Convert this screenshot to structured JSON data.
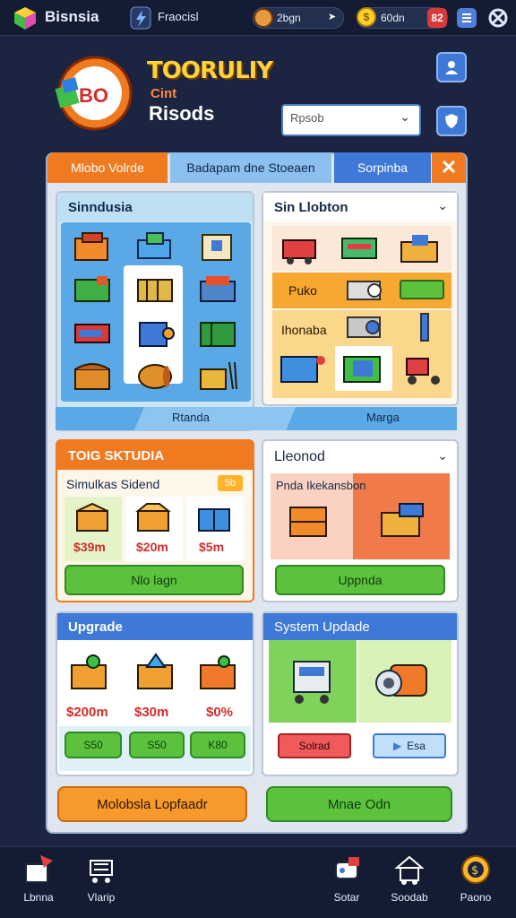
{
  "topbar": {
    "app_name": "Bisnsia",
    "section": "Fraocisl",
    "stat1": "2bgn",
    "stat2": "60dn",
    "badge": "82"
  },
  "header": {
    "logo_text": "BO",
    "title_line1": "TOORULIY",
    "title_line2": "Cint",
    "title_line3": "Risods",
    "search_placeholder": "Rpsob"
  },
  "tabs": [
    {
      "label": "Mlobo Volrde"
    },
    {
      "label": "Badapam dne Stoeaen"
    },
    {
      "label": "Sorpinba"
    }
  ],
  "simulation_card": {
    "title": "Sinndusia",
    "footer_left": "Rtanda",
    "footer_right": "Marga"
  },
  "station_card": {
    "title": "Sin Llobton",
    "row1_label": "Puko",
    "row2_label": "Ihonaba"
  },
  "shop_card": {
    "header": "TOIG SKTUDIA",
    "subtitle": "Simulkas Sidend",
    "badge": "5b",
    "prices": [
      "$39m",
      "$20m",
      "$5m"
    ],
    "button": "Nlo lagn"
  },
  "lleonod_card": {
    "title": "Lleonod",
    "subtitle": "Pnda Ikekansbon",
    "button": "Uppnda"
  },
  "upgrade_card": {
    "title": "Upgrade",
    "prices": [
      "$200m",
      "$30m",
      "$0%"
    ],
    "buttons": [
      "S50",
      "S50",
      "K80"
    ]
  },
  "system_update_card": {
    "title": "System Updade",
    "button_red": "Solrad",
    "button_blue": "Esa"
  },
  "bottom_buttons": {
    "left": "Molobsla Lopfaadr",
    "right": "Mnae Odn"
  },
  "nav": [
    {
      "label": "Lbnna",
      "icon": "box-arrow-icon"
    },
    {
      "label": "Vlarip",
      "icon": "cart-icon"
    },
    {
      "label": "Sotar",
      "icon": "robot-icon"
    },
    {
      "label": "Soodab",
      "icon": "house-icon"
    },
    {
      "label": "Paono",
      "icon": "coin-icon"
    }
  ],
  "colors": {
    "background": "#1b2440",
    "accent_orange": "#f07a20",
    "accent_blue": "#3f79d8",
    "accent_green": "#5cc23e",
    "title_yellow": "#ffd23a"
  }
}
